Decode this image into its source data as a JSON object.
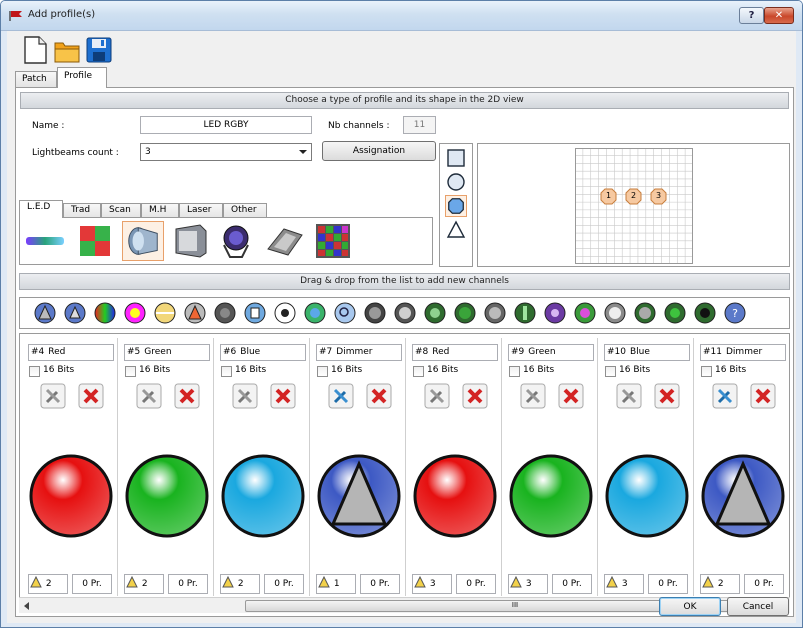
{
  "window": {
    "title": "Add profile(s)",
    "help_label": "?",
    "close_label": "✕"
  },
  "tabs": [
    {
      "label": "Patch"
    },
    {
      "label": "Profile"
    }
  ],
  "profile": {
    "header": "Choose a type of profile and its shape in the 2D view",
    "name_label": "Name :",
    "name_value": "LED RGBY",
    "nb_channels_label": "Nb channels :",
    "nb_channels_value": "11",
    "lightbeams_label": "Lightbeams count :",
    "lightbeams_value": "3",
    "assignation_label": "Assignation",
    "type_tabs": [
      {
        "label": "L.E.D"
      },
      {
        "label": "Trad"
      },
      {
        "label": "Scan"
      },
      {
        "label": "M.H"
      },
      {
        "label": "Laser"
      },
      {
        "label": "Other"
      }
    ],
    "beams": [
      {
        "label": "1"
      },
      {
        "label": "2"
      },
      {
        "label": "3"
      }
    ]
  },
  "channels_header": "Drag & drop from the list to add new channels",
  "channels": [
    {
      "num": "#4",
      "name": "Red",
      "bits": "16 Bits",
      "value": "2",
      "preset": "0 Pr.",
      "color": "#e61010"
    },
    {
      "num": "#5",
      "name": "Green",
      "bits": "16 Bits",
      "value": "2",
      "preset": "0 Pr.",
      "color": "#19b31f"
    },
    {
      "num": "#6",
      "name": "Blue",
      "bits": "16 Bits",
      "value": "2",
      "preset": "0 Pr.",
      "color": "#1aa8df"
    },
    {
      "num": "#7",
      "name": "Dimmer",
      "bits": "16 Bits",
      "value": "1",
      "preset": "0 Pr.",
      "color": "#3d59c4"
    },
    {
      "num": "#8",
      "name": "Red",
      "bits": "16 Bits",
      "value": "3",
      "preset": "0 Pr.",
      "color": "#e61010"
    },
    {
      "num": "#9",
      "name": "Green",
      "bits": "16 Bits",
      "value": "3",
      "preset": "0 Pr.",
      "color": "#19b31f"
    },
    {
      "num": "#10",
      "name": "Blue",
      "bits": "16 Bits",
      "value": "3",
      "preset": "0 Pr.",
      "color": "#1aa8df"
    },
    {
      "num": "#11",
      "name": "Dimmer",
      "bits": "16 Bits",
      "value": "2",
      "preset": "0 Pr.",
      "color": "#3d59c4"
    }
  ],
  "scroll_label": "III",
  "buttons": {
    "ok": "OK",
    "cancel": "Cancel"
  }
}
